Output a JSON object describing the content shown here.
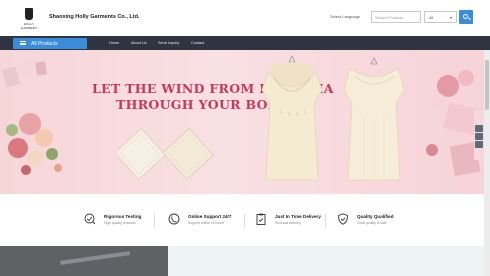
{
  "header": {
    "logo_text": "HOLLY GARMENT",
    "company_name": "Shaoxing Holly Garments Co., Ltd.",
    "language_label": "Select Language",
    "search_placeholder": "Search Products",
    "search_scope": "All"
  },
  "nav": {
    "all_products": "All Products",
    "links": [
      "Home",
      "About Us",
      "Send Inquiry",
      "Contact"
    ]
  },
  "banner": {
    "line1": "LET THE WIND FROM BOHEMIA",
    "line2": "THROUGH YOUR BODY",
    "slides": 2,
    "active_slide": 1
  },
  "features": [
    {
      "title": "Rigorous Testing",
      "subtitle": "High quality products",
      "icon": "check-chart-icon"
    },
    {
      "title": "Online Support 24/7",
      "subtitle": "Support online 24 hours",
      "icon": "phone-icon"
    },
    {
      "title": "Just In Time Delivery",
      "subtitle": "Punctual delivery",
      "icon": "clipboard-check-icon"
    },
    {
      "title": "Quality Qualified",
      "subtitle": "Good quality is safe",
      "icon": "shield-check-icon"
    }
  ],
  "colors": {
    "accent": "#3a8ddb",
    "nav_bg": "#2f3540",
    "headline": "#c7395b",
    "banner_bg": "#f8dadd"
  }
}
